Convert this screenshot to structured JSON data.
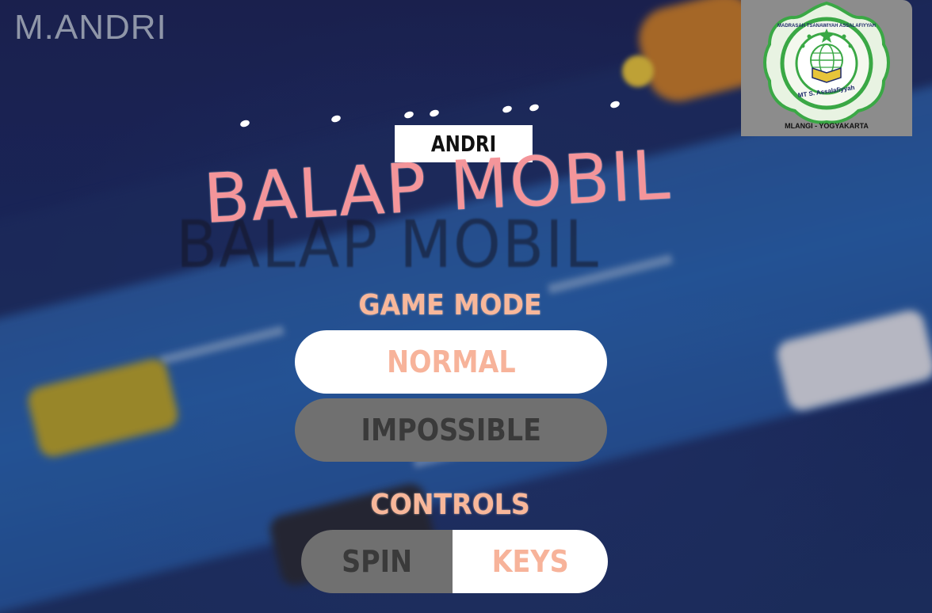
{
  "header": {
    "brand": "M.ANDRI",
    "logo": {
      "top_text": "MADRASAH TSANAWIYAH ASSALAFIYYAH",
      "inner_text": "MT S. Assalafiyyah",
      "bottom_text": "MLANGI - YOGYAKARTA",
      "colors": {
        "ring": "#3aa845",
        "ink": "#1d2a6a",
        "background": "#8c8c8c"
      }
    }
  },
  "title": {
    "name_tag": "ANDRI",
    "main": "BALAP MOBIL",
    "main_color": "#f4959a"
  },
  "game_mode": {
    "label": "GAME MODE",
    "options": [
      {
        "label": "NORMAL",
        "selected": true
      },
      {
        "label": "IMPOSSIBLE",
        "selected": false
      }
    ]
  },
  "controls": {
    "label": "CONTROLS",
    "options": [
      {
        "label": "SPIN",
        "selected": false
      },
      {
        "label": "KEYS",
        "selected": true
      }
    ]
  },
  "colors": {
    "accent": "#f8b79a",
    "selected_bg": "#ffffff",
    "unselected_bg": "#707070",
    "unselected_text": "#3a3a3a",
    "background": "#1e2456",
    "road": "#2b67b4"
  }
}
